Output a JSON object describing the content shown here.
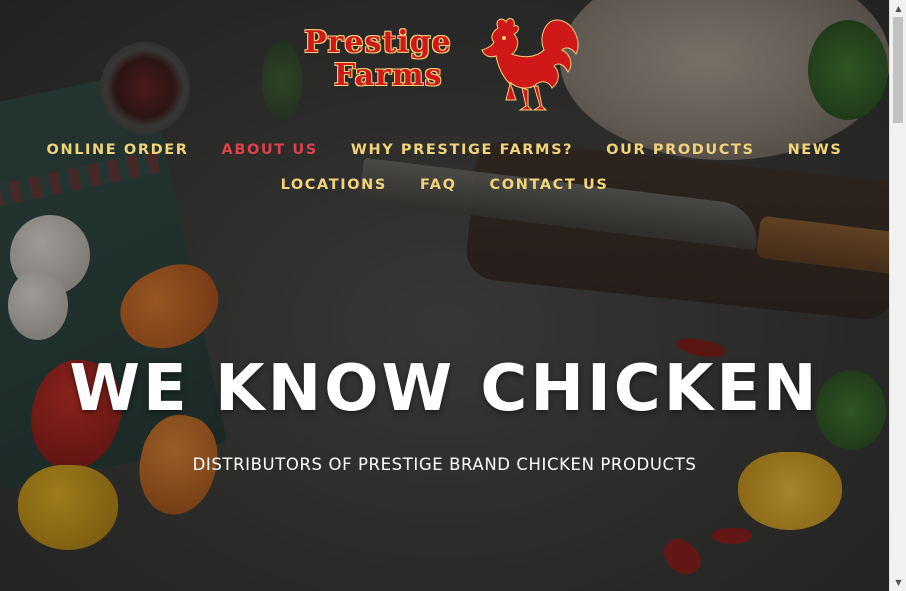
{
  "brand": {
    "logo_line1": "Prestige",
    "logo_line2": "Farms",
    "logo_icon": "rooster-icon",
    "colors": {
      "logo_red": "#d01818",
      "logo_outline": "#f5d27a"
    }
  },
  "nav": {
    "row1": [
      {
        "label": "ONLINE ORDER",
        "active": false
      },
      {
        "label": "ABOUT US",
        "active": true
      },
      {
        "label": "WHY PRESTIGE FARMS?",
        "active": false
      },
      {
        "label": "OUR PRODUCTS",
        "active": false
      },
      {
        "label": "NEWS",
        "active": false
      }
    ],
    "row2": [
      {
        "label": "LOCATIONS",
        "active": false
      },
      {
        "label": "FAQ",
        "active": false
      },
      {
        "label": "CONTACT US",
        "active": false
      }
    ],
    "colors": {
      "link": "#f0d37a",
      "active": "#e0404a"
    }
  },
  "hero": {
    "title": "WE KNOW CHICKEN",
    "subtitle": "DISTRIBUTORS OF PRESTIGE BRAND CHICKEN PRODUCTS"
  },
  "scrollbar": {
    "up_icon": "scroll-up-arrow-icon",
    "down_icon": "scroll-down-arrow-icon"
  }
}
